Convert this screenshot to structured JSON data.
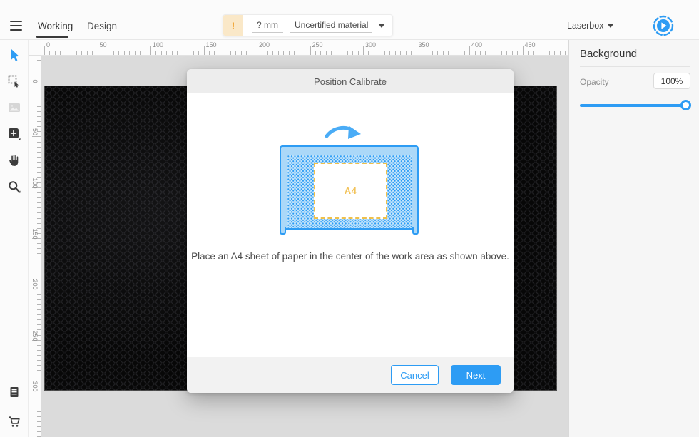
{
  "topbar": {
    "tabs": [
      {
        "label": "Working",
        "active": true
      },
      {
        "label": "Design",
        "active": false
      }
    ],
    "material_bar": {
      "warning_symbol": "!",
      "thickness_value": "? mm",
      "material_name": "Uncertified material"
    },
    "device_selector": {
      "label": "Laserbox"
    }
  },
  "toolbox": {
    "tools": [
      {
        "name": "select",
        "active": true
      },
      {
        "name": "node-select",
        "active": false
      },
      {
        "name": "image",
        "active": false,
        "disabled": true
      },
      {
        "name": "add-shape",
        "active": false
      },
      {
        "name": "pan-hand",
        "active": false
      },
      {
        "name": "zoom",
        "active": false
      },
      {
        "name": "log",
        "active": false
      },
      {
        "name": "store-cart",
        "active": false
      }
    ]
  },
  "rulers": {
    "unit": "mm",
    "minor_step_mm": 5,
    "major_step_mm": 50,
    "horizontal_labels": [
      0,
      50,
      100,
      150,
      200,
      250,
      300,
      350,
      400,
      450
    ],
    "vertical_labels": [
      0,
      50,
      100,
      150,
      200,
      250,
      300
    ]
  },
  "dialog": {
    "title": "Position Calibrate",
    "illustration": {
      "paper_label": "A4"
    },
    "message": "Place an A4 sheet of paper in the center of the work area as shown above.",
    "buttons": {
      "cancel": "Cancel",
      "next": "Next"
    }
  },
  "right_panel": {
    "title": "Background",
    "opacity_label": "Opacity",
    "opacity_value": "100%",
    "opacity_percent": 100
  },
  "colors": {
    "accent_blue": "#2D9CF4",
    "machine_fill": "#ABD8F8",
    "mesh_fill": "#C9E7FB",
    "warning_orange": "#EFA12D",
    "warning_bg": "#FAE8C8",
    "paper_yellow": "#EFC04A",
    "bed_black": "#080808"
  }
}
